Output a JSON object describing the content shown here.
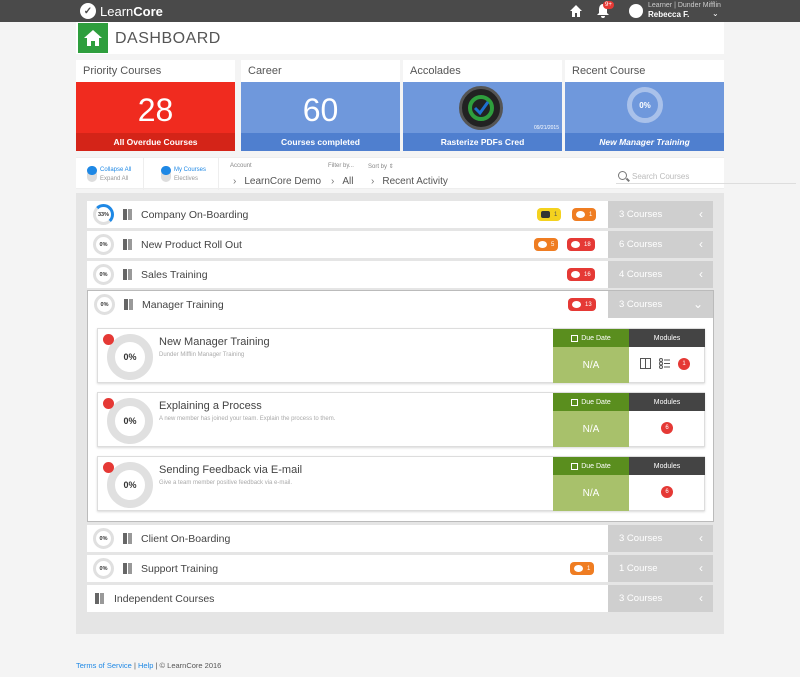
{
  "topbar": {
    "logo_light": "Learn",
    "logo_bold": "Core",
    "notification_count": "9+",
    "user_role": "Learner | Dunder Mifflin",
    "user_name": "Rebecca F."
  },
  "dashboard": {
    "title": "DASHBOARD"
  },
  "cards": {
    "priority": {
      "header": "Priority Courses",
      "value": "28",
      "footer": "All Overdue Courses",
      "color": "#f02b1f"
    },
    "career": {
      "header": "Career",
      "value": "60",
      "footer": "Courses completed",
      "color": "#6f98dc"
    },
    "accolades": {
      "header": "Accolades",
      "date": "09/21/2015",
      "footer": "Rasterize PDFs Cred",
      "color": "#6f98dc"
    },
    "recent": {
      "header": "Recent Course",
      "percent": "0%",
      "footer": "New Manager Training",
      "color": "#6f98dc"
    }
  },
  "filters": {
    "collapse_all": "Collapse All",
    "expand_all": "Expand All",
    "my_courses": "My Courses",
    "electives": "Electives",
    "account_label": "Account",
    "account_value": "LearnCore Demo",
    "filter_label": "Filter by...",
    "filter_value": "All",
    "sort_label": "Sort by",
    "sort_value": "Recent Activity",
    "search_placeholder": "Search Courses"
  },
  "rows": [
    {
      "progress": "33%",
      "title": "Company On-Boarding",
      "pills": [
        "1",
        "1"
      ],
      "courses": "3 Courses"
    },
    {
      "progress": "0%",
      "title": "New Product Roll Out",
      "pills": [
        "5",
        "18"
      ],
      "courses": "6 Courses"
    },
    {
      "progress": "0%",
      "title": "Sales Training",
      "pills": [
        "16"
      ],
      "courses": "4 Courses"
    },
    {
      "progress": "0%",
      "title": "Manager Training",
      "pills": [
        "13"
      ],
      "courses": "3 Courses"
    },
    {
      "progress": "0%",
      "title": "Client On-Boarding",
      "courses": "3 Courses"
    },
    {
      "progress": "0%",
      "title": "Support Training",
      "pills": [
        "1"
      ],
      "courses": "1 Course"
    },
    {
      "title": "Independent Courses",
      "courses": "3 Courses"
    }
  ],
  "subcourses": [
    {
      "progress": "0%",
      "title": "New Manager Training",
      "desc": "Dunder Mifflin Manager Training",
      "due_label": "Due Date",
      "due_value": "N/A",
      "modules_label": "Modules",
      "modules_count": "1"
    },
    {
      "progress": "0%",
      "title": "Explaining a Process",
      "desc": "A new member has joined your team. Explain the process to them.",
      "due_label": "Due Date",
      "due_value": "N/A",
      "modules_label": "Modules",
      "modules_count": "6"
    },
    {
      "progress": "0%",
      "title": "Sending Feedback via E-mail",
      "desc": "Give a team member positive feedback via e-mail.",
      "due_label": "Due Date",
      "due_value": "N/A",
      "modules_label": "Modules",
      "modules_count": "6"
    }
  ],
  "footer": {
    "terms": "Terms of Service",
    "sep1": " | ",
    "help": "Help",
    "copyright": " | © LearnCore 2016"
  }
}
